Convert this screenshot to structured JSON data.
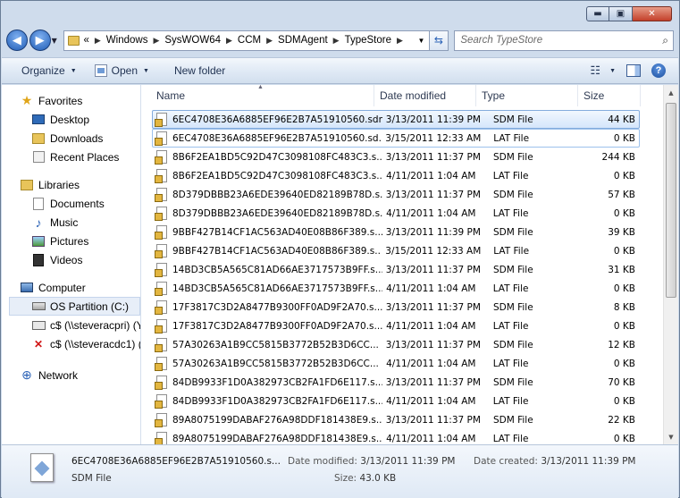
{
  "window": {
    "minimize": "▬",
    "maximize": "▣",
    "close": "✕"
  },
  "address": {
    "prefix": "«",
    "crumbs": [
      "Windows",
      "SysWOW64",
      "CCM",
      "SDMAgent",
      "TypeStore"
    ]
  },
  "search": {
    "placeholder": "Search TypeStore"
  },
  "toolbar": {
    "organize": "Organize",
    "open": "Open",
    "new_folder": "New folder"
  },
  "nav": {
    "favorites": {
      "label": "Favorites",
      "items": [
        "Desktop",
        "Downloads",
        "Recent Places"
      ]
    },
    "libraries": {
      "label": "Libraries",
      "items": [
        "Documents",
        "Music",
        "Pictures",
        "Videos"
      ]
    },
    "computer": {
      "label": "Computer",
      "items": [
        "OS Partition (C:)",
        "c$ (\\\\steveracpri) (Y:",
        "c$ (\\\\steveracdc1) (Z"
      ]
    },
    "network": {
      "label": "Network"
    }
  },
  "columns": {
    "name": "Name",
    "date": "Date modified",
    "type": "Type",
    "size": "Size"
  },
  "files": [
    {
      "name": "6EC4708E36A6885EF96E2B7A51910560.sdm",
      "date": "3/13/2011 11:39 PM",
      "type": "SDM File",
      "size": "44 KB"
    },
    {
      "name": "6EC4708E36A6885EF96E2B7A51910560.sd...",
      "date": "3/15/2011 12:33 AM",
      "type": "LAT File",
      "size": "0 KB"
    },
    {
      "name": "8B6F2EA1BD5C92D47C3098108FC483C3.s...",
      "date": "3/13/2011 11:37 PM",
      "type": "SDM File",
      "size": "244 KB"
    },
    {
      "name": "8B6F2EA1BD5C92D47C3098108FC483C3.s...",
      "date": "4/11/2011 1:04 AM",
      "type": "LAT File",
      "size": "0 KB"
    },
    {
      "name": "8D379DBBB23A6EDE39640ED82189B78D.s...",
      "date": "3/13/2011 11:37 PM",
      "type": "SDM File",
      "size": "57 KB"
    },
    {
      "name": "8D379DBBB23A6EDE39640ED82189B78D.s...",
      "date": "4/11/2011 1:04 AM",
      "type": "LAT File",
      "size": "0 KB"
    },
    {
      "name": "9BBF427B14CF1AC563AD40E08B86F389.s...",
      "date": "3/13/2011 11:39 PM",
      "type": "SDM File",
      "size": "39 KB"
    },
    {
      "name": "9BBF427B14CF1AC563AD40E08B86F389.s...",
      "date": "3/15/2011 12:33 AM",
      "type": "LAT File",
      "size": "0 KB"
    },
    {
      "name": "14BD3CB5A565C81AD66AE3717573B9FF.s...",
      "date": "3/13/2011 11:37 PM",
      "type": "SDM File",
      "size": "31 KB"
    },
    {
      "name": "14BD3CB5A565C81AD66AE3717573B9FF.s...",
      "date": "4/11/2011 1:04 AM",
      "type": "LAT File",
      "size": "0 KB"
    },
    {
      "name": "17F3817C3D2A8477B9300FF0AD9F2A70.s...",
      "date": "3/13/2011 11:37 PM",
      "type": "SDM File",
      "size": "8 KB"
    },
    {
      "name": "17F3817C3D2A8477B9300FF0AD9F2A70.s...",
      "date": "4/11/2011 1:04 AM",
      "type": "LAT File",
      "size": "0 KB"
    },
    {
      "name": "57A30263A1B9CC5815B3772B52B3D6CC...",
      "date": "3/13/2011 11:37 PM",
      "type": "SDM File",
      "size": "12 KB"
    },
    {
      "name": "57A30263A1B9CC5815B3772B52B3D6CC...",
      "date": "4/11/2011 1:04 AM",
      "type": "LAT File",
      "size": "0 KB"
    },
    {
      "name": "84DB9933F1D0A382973CB2FA1FD6E117.s...",
      "date": "3/13/2011 11:37 PM",
      "type": "SDM File",
      "size": "70 KB"
    },
    {
      "name": "84DB9933F1D0A382973CB2FA1FD6E117.s...",
      "date": "4/11/2011 1:04 AM",
      "type": "LAT File",
      "size": "0 KB"
    },
    {
      "name": "89A8075199DABAF276A98DDF181438E9.s...",
      "date": "3/13/2011 11:37 PM",
      "type": "SDM File",
      "size": "22 KB"
    },
    {
      "name": "89A8075199DABAF276A98DDF181438E9.s...",
      "date": "4/11/2011 1:04 AM",
      "type": "LAT File",
      "size": "0 KB"
    }
  ],
  "details": {
    "name": "6EC4708E36A6885EF96E2B7A51910560.s...",
    "type": "SDM File",
    "modified_label": "Date modified:",
    "modified_value": "3/13/2011 11:39 PM",
    "size_label": "Size:",
    "size_value": "43.0 KB",
    "created_label": "Date created:",
    "created_value": "3/13/2011 11:39 PM"
  }
}
